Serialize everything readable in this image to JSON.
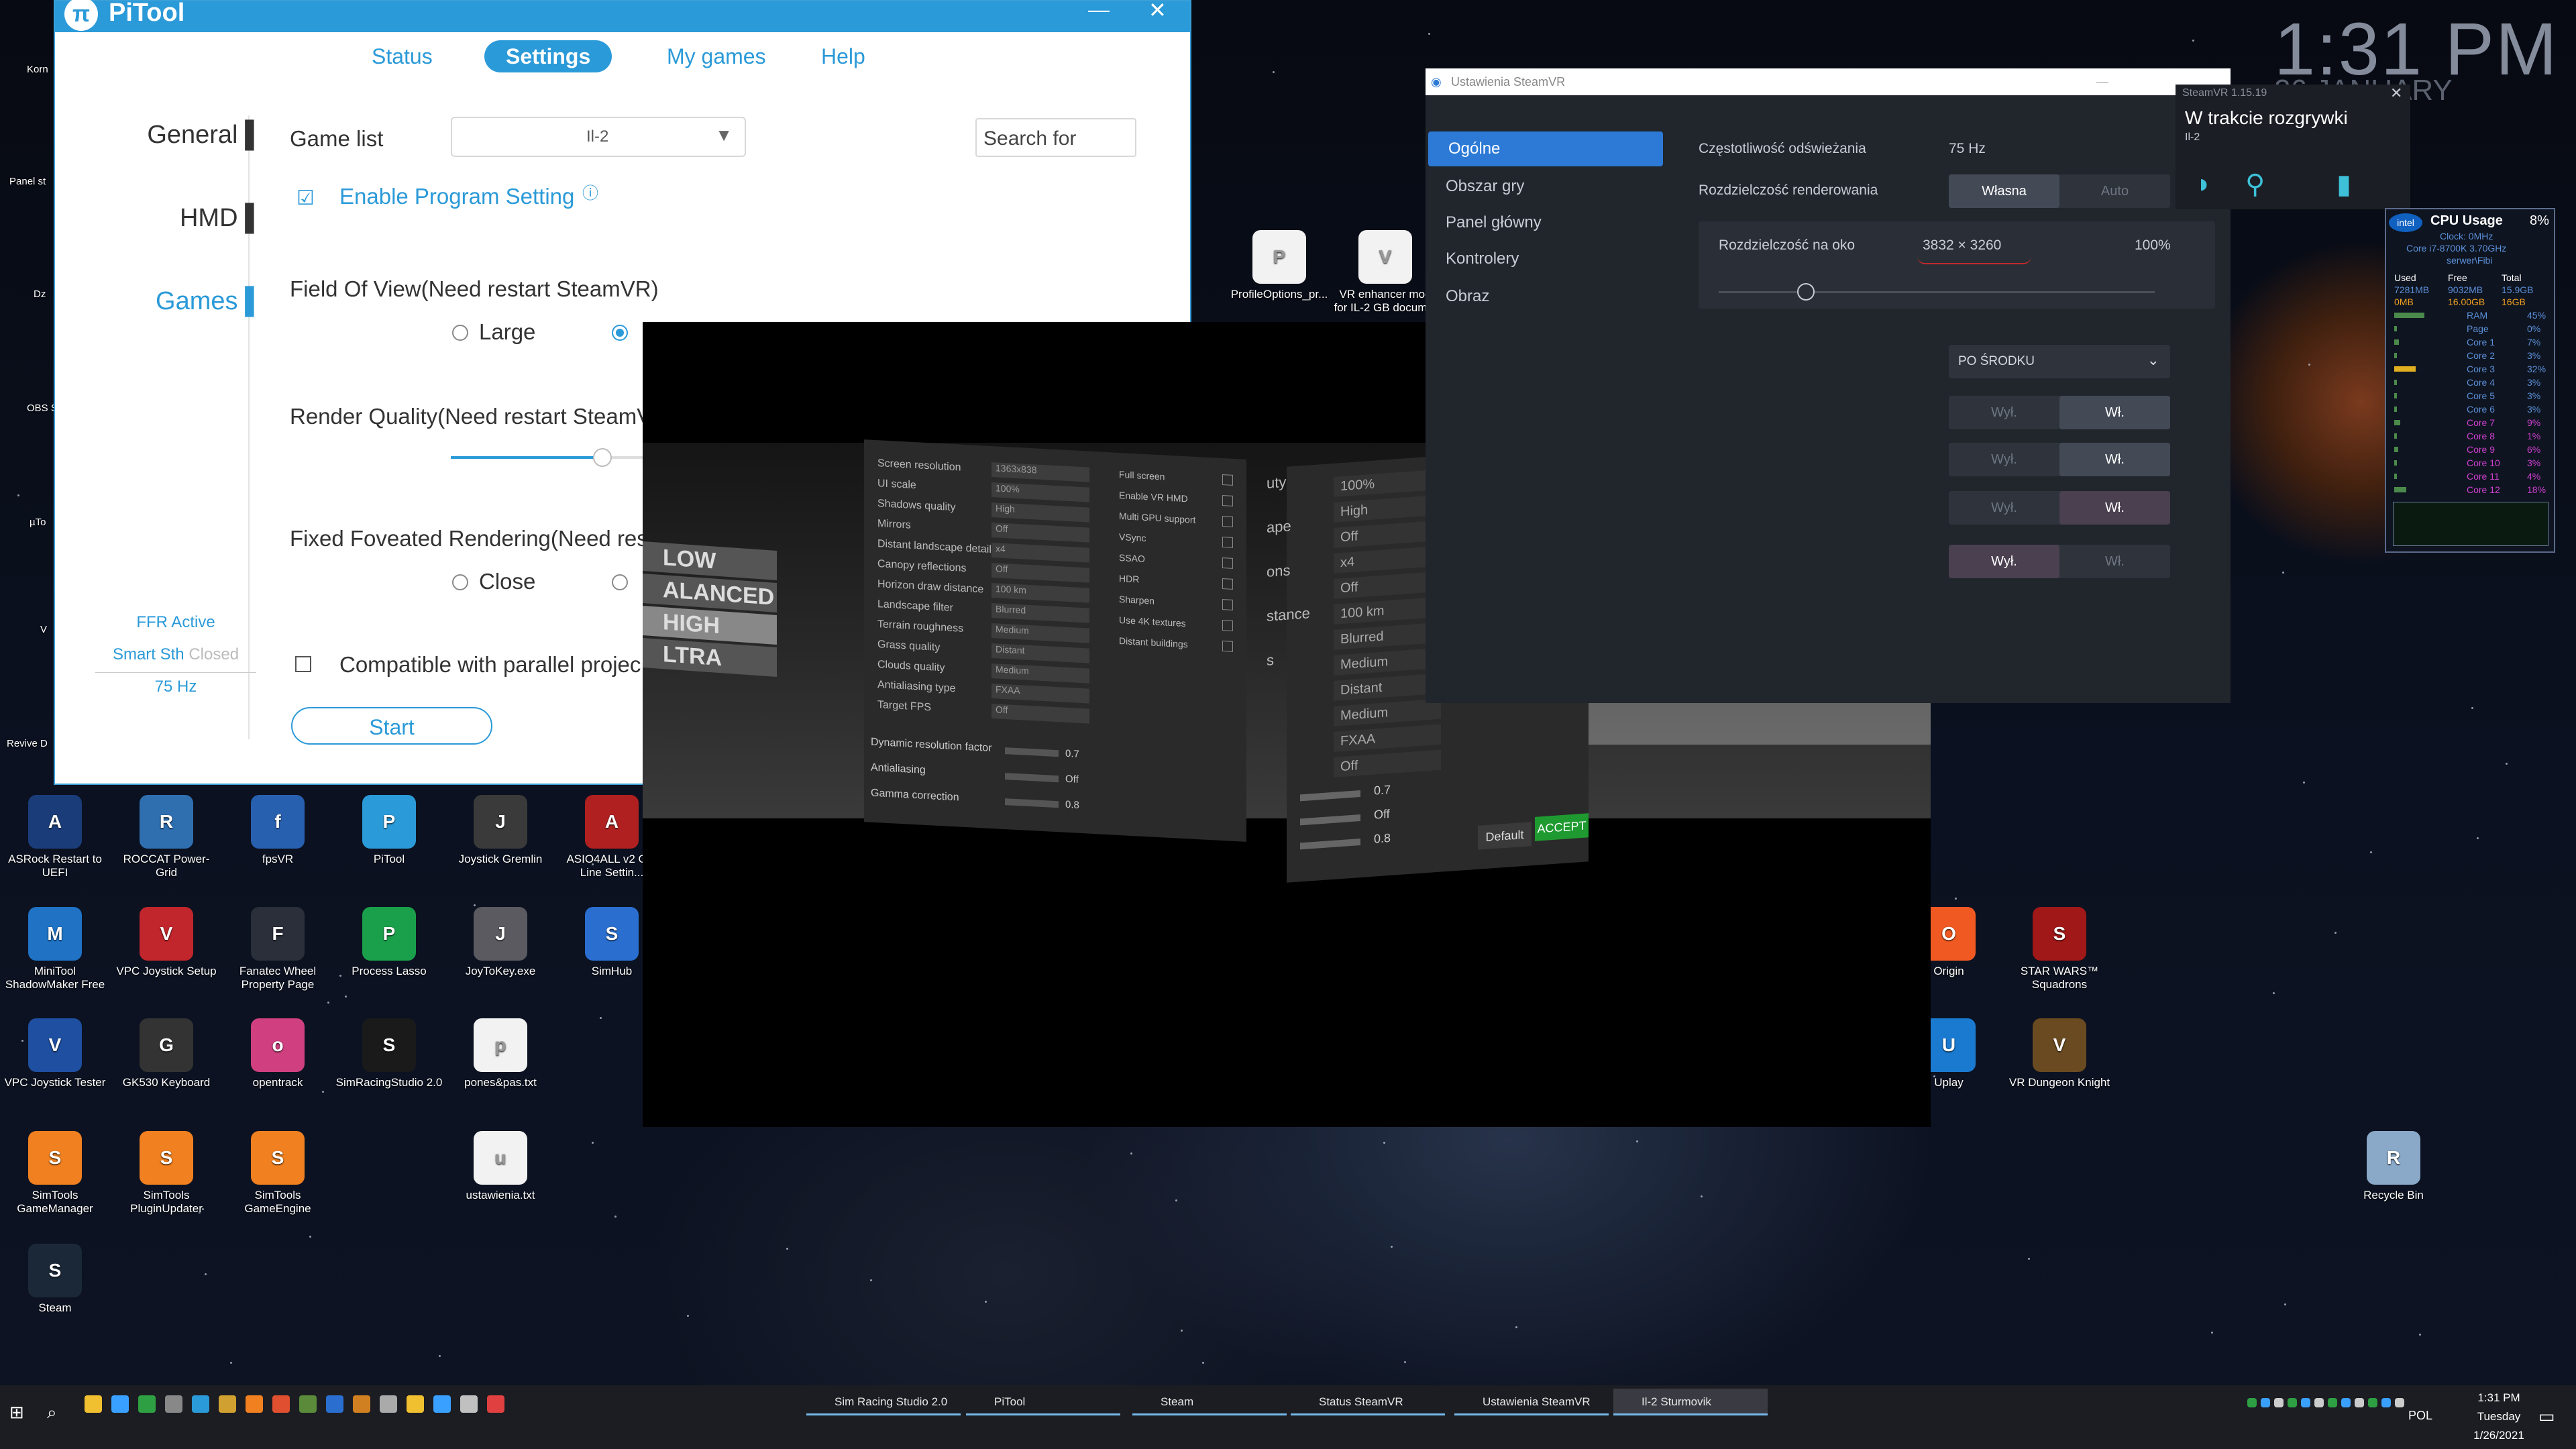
{
  "desktop": {
    "clock_time": "1:31 PM",
    "clock_date_partial": "26 JANUARY",
    "clock_day_partial": "AY",
    "icons": [
      {
        "label": "ASRock Restart to UEFI",
        "color": "#1a3d7a"
      },
      {
        "label": "ROCCAT Power-Grid",
        "color": "#2f6fb0"
      },
      {
        "label": "fpsVR",
        "color": "#2860b0"
      },
      {
        "label": "PiTool",
        "color": "#2b9ad8"
      },
      {
        "label": "Joystick Gremlin",
        "color": "#3a3a3a"
      },
      {
        "label": "ASIO4ALL v2 Off-Line Settin...",
        "color": "#b02020"
      },
      {
        "label": "MiniTool ShadowMaker Free",
        "color": "#1f72c4"
      },
      {
        "label": "VPC Joystick Setup",
        "color": "#c0262b"
      },
      {
        "label": "Fanatec Wheel Property Page",
        "color": "#2a2f3a"
      },
      {
        "label": "Process Lasso",
        "color": "#1aa04a"
      },
      {
        "label": "JoyToKey.exe",
        "color": "#5a5a60"
      },
      {
        "label": "SimHub",
        "color": "#2a6fd0"
      },
      {
        "label": "VPC Joystick Tester",
        "color": "#1f4fa0"
      },
      {
        "label": "GK530 Keyboard",
        "color": "#333"
      },
      {
        "label": "opentrack",
        "color": "#d04080"
      },
      {
        "label": "SimRacingStudio 2.0",
        "color": "#1a1a1a"
      },
      {
        "label": "pones&pas.txt",
        "color": "#f2f2f2"
      },
      {
        "label": "SimTools GameManager",
        "color": "#f08020"
      },
      {
        "label": "SimTools PluginUpdater",
        "color": "#f08020"
      },
      {
        "label": "SimTools GameEngine",
        "color": "#f08020"
      },
      {
        "label": "ustawienia.txt",
        "color": "#f2f2f2"
      },
      {
        "label": "Steam",
        "color": "#1b2838"
      },
      {
        "label": "Origin",
        "color": "#f05a22"
      },
      {
        "label": "STAR WARS™ Squadrons",
        "color": "#a01818"
      },
      {
        "label": "Uplay",
        "color": "#1a7ad0"
      },
      {
        "label": "VR Dungeon Knight",
        "color": "#6a4a20"
      },
      {
        "label": "Recycle Bin",
        "color": "#8aa8c8"
      },
      {
        "label": "ProfileOptions_pr...",
        "color": "#f2f2f2"
      },
      {
        "label": "VR enhancer mod for IL-2 GB docum...",
        "color": "#f2f2f2"
      }
    ],
    "partial_labels": [
      "Korn",
      "Panel st",
      "Dz",
      "OBS S",
      "µTo",
      "V",
      "Revive D"
    ]
  },
  "pitool": {
    "title": "PiTool",
    "tabs": [
      "Status",
      "Settings",
      "My games",
      "Help"
    ],
    "side": [
      "General",
      "HMD",
      "Games"
    ],
    "game_list_label": "Game list",
    "game_list_value": "Il-2",
    "search_placeholder": "Search for",
    "enable_program_setting": "Enable Program Setting",
    "fov_label": "Field Of View(Need restart SteamVR)",
    "fov_large": "Large",
    "render_quality_label": "Render Quality(Need restart SteamV",
    "ffr_label": "Fixed Foveated Rendering(Need rest",
    "ffr_close": "Close",
    "parallel_label": "Compatible with parallel projec",
    "start_button": "Start",
    "status_ffr": "FFR Active",
    "status_smart": "Smart Sth",
    "status_closed": "Closed",
    "status_hz": "75 Hz"
  },
  "game": {
    "quality_presets": [
      "LOW",
      "ALANCED",
      "HIGH",
      "LTRA"
    ],
    "left_rows": [
      {
        "label": "Screen resolution",
        "value": "1363x838"
      },
      {
        "label": "UI scale",
        "value": "100%"
      },
      {
        "label": "Shadows quality",
        "value": "High"
      },
      {
        "label": "Mirrors",
        "value": "Off"
      },
      {
        "label": "Distant landscape detail",
        "value": "x4"
      },
      {
        "label": "Canopy reflections",
        "value": "Off"
      },
      {
        "label": "Horizon draw distance",
        "value": "100 km"
      },
      {
        "label": "Landscape filter",
        "value": "Blurred"
      },
      {
        "label": "Terrain roughness",
        "value": "Medium"
      },
      {
        "label": "Grass quality",
        "value": "Distant"
      },
      {
        "label": "Clouds quality",
        "value": "Medium"
      },
      {
        "label": "Antialiasing type",
        "value": "FXAA"
      },
      {
        "label": "Target FPS",
        "value": "Off"
      }
    ],
    "toggles": [
      "Full screen",
      "Enable VR HMD",
      "Multi GPU support",
      "VSync",
      "SSAO",
      "HDR",
      "Sharpen",
      "Use 4K textures",
      "Distant buildings"
    ],
    "sliders": [
      {
        "label": "Dynamic resolution factor",
        "value": "0.7"
      },
      {
        "label": "Antialiasing",
        "value": "Off"
      },
      {
        "label": "Gamma correction",
        "value": "0.8"
      }
    ],
    "right_values": [
      "100%",
      "High",
      "Off",
      "x4",
      "Off",
      "100 km",
      "Blurred",
      "Medium",
      "Distant",
      "Medium",
      "FXAA",
      "Off"
    ],
    "right_sliders": [
      "0.7",
      "Off",
      "0.8"
    ],
    "right_partial_labels": [
      "uty",
      "ape",
      "ons",
      "stance",
      "s"
    ],
    "btn_default": "Default",
    "btn_accept": "ACCEPT"
  },
  "steamvr_settings": {
    "title": "Ustawienia SteamVR",
    "nav": [
      "Ogólne",
      "Obszar gry",
      "Panel główny",
      "Kontrolery",
      "Obraz"
    ],
    "refresh_label": "Częstotliwość odświeżania",
    "refresh_value": "75 Hz",
    "render_res_label": "Rozdzielczość renderowania",
    "render_res_custom": "Własna",
    "render_res_auto": "Auto",
    "per_eye_label": "Rozdzielczość na oko",
    "per_eye_value": "3832 × 3260",
    "per_eye_percent": "100%",
    "per_eye_slider": 0.2,
    "dropdown_value": "PO ŚRODKU",
    "off": "Wył.",
    "on": "Wł."
  },
  "steamvr_status": {
    "title": "SteamVR 1.15.19",
    "status": "W trakcie rozgrywki",
    "game": "Il-2"
  },
  "cpu_widget": {
    "title": "CPU Usage",
    "percent": "8%",
    "clock": "Clock: 0MHz",
    "model": "Core i7-8700K 3.70GHz",
    "host": "serwer\\Fibi",
    "headers": [
      "Used",
      "Free",
      "Total"
    ],
    "ram_row": [
      "7281MB",
      "9032MB",
      "15.9GB"
    ],
    "page_row": [
      "0MB",
      "16.00GB",
      "16GB"
    ],
    "rows": [
      {
        "label": "RAM",
        "value": "45%"
      },
      {
        "label": "Page",
        "value": "0%"
      },
      {
        "label": "Core 1",
        "value": "7%"
      },
      {
        "label": "Core 2",
        "value": "3%"
      },
      {
        "label": "Core 3",
        "value": "32%"
      },
      {
        "label": "Core 4",
        "value": "3%"
      },
      {
        "label": "Core 5",
        "value": "3%"
      },
      {
        "label": "Core 6",
        "value": "3%"
      },
      {
        "label": "Core 7",
        "value": "9%"
      },
      {
        "label": "Core 8",
        "value": "1%"
      },
      {
        "label": "Core 9",
        "value": "6%"
      },
      {
        "label": "Core 10",
        "value": "3%"
      },
      {
        "label": "Core 11",
        "value": "4%"
      },
      {
        "label": "Core 12",
        "value": "18%"
      }
    ]
  },
  "taskbar": {
    "apps": [
      "Sim Racing Studio 2.0",
      "PiTool",
      "Steam",
      "Status SteamVR",
      "Ustawienia SteamVR",
      "Il-2 Sturmovik"
    ],
    "time": "1:31 PM",
    "day": "Tuesday",
    "date": "1/26/2021",
    "lang": "POL"
  }
}
